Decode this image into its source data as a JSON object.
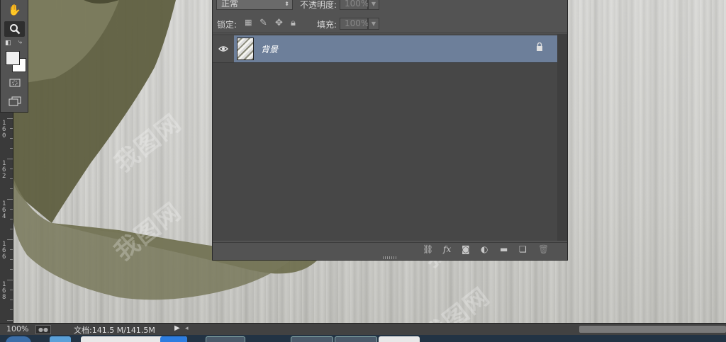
{
  "status_bar": {
    "zoom": "100%",
    "doc_info": "文档:141.5 M/141.5M",
    "play_arrow": "▶",
    "left_arrow": "◂"
  },
  "ruler": {
    "labels": [
      {
        "id": "r160",
        "text": "1\n6\n0"
      },
      {
        "id": "r162",
        "text": "1\n6\n2"
      },
      {
        "id": "r164",
        "text": "1\n6\n4"
      },
      {
        "id": "r166",
        "text": "1\n6\n6"
      },
      {
        "id": "r168",
        "text": "1\n6\n8"
      }
    ]
  },
  "tools": {
    "hand": "✋",
    "zoom": "🔍",
    "quick_mask": "◌",
    "screen_mode": "❐"
  },
  "layers_panel": {
    "blend_mode": "正常",
    "opacity_label": "不透明度:",
    "opacity_value": "100%",
    "lock_label": "锁定:",
    "fill_label": "填充:",
    "fill_value": "100%",
    "layers": [
      {
        "name": "背景",
        "visible": true,
        "locked": true,
        "selected": true
      }
    ]
  },
  "watermark": "我图网",
  "colors": {
    "panel": "#535353",
    "selected_layer": "#6d7f9a",
    "canvas_shape": "#6f6f50"
  }
}
